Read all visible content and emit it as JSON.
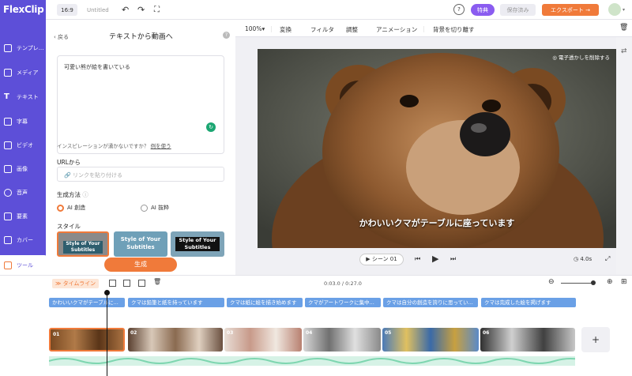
{
  "app": {
    "logo": "FlexClip"
  },
  "sidebar": {
    "items": [
      {
        "label": "テンプレ..."
      },
      {
        "label": "メディア"
      },
      {
        "label": "テキスト"
      },
      {
        "label": "字幕"
      },
      {
        "label": "ビデオ"
      },
      {
        "label": "画像"
      },
      {
        "label": "音声"
      },
      {
        "label": "要素"
      },
      {
        "label": "カバー"
      },
      {
        "label": "ツール"
      }
    ]
  },
  "topbar": {
    "ratio": "16:9",
    "title": "Untitled",
    "special": "特典",
    "save": "保存済み",
    "export": "エクスポート"
  },
  "panel": {
    "back": "戻る",
    "title": "テキストから動画へ",
    "prompt": "可愛い熊が絵を書いている",
    "inspiration": "インスピレーションが湧かないですか？",
    "example_link": "例を使う",
    "url_label": "URLから",
    "url_placeholder": "リンクを貼り付ける",
    "method_label": "生成方法",
    "method_ai_create": "AI 創造",
    "method_ai_extract": "AI 抜粋",
    "style_label": "スタイル",
    "style_card_text": "Style of Your Subtitles",
    "generate": "生成"
  },
  "toolbar": {
    "zoom": "100%",
    "items": [
      "変換",
      "フィルタ",
      "調整",
      "アニメーション",
      "背景を切り離す"
    ]
  },
  "preview": {
    "watermark": "電子透かしを削除する",
    "subtitle": "かわいいクマがテーブルに座っています",
    "scene": "シーン 01",
    "duration": "4.0s"
  },
  "timeline": {
    "label": "タイムライン",
    "time": "0:03.0 / 0:27.0",
    "subtitles": [
      "かわいいクマがテーブルに...",
      "クマは鉛筆と紙を持っています",
      "クマは紙に絵を描き始めます",
      "クマがアートワークに集中...",
      "クマは自分の創造を誇りに思ってい...",
      "クマは完成した絵を掲げます"
    ],
    "clips": [
      "01",
      "02",
      "03",
      "04",
      "05",
      "06"
    ],
    "add": "+"
  },
  "colors": {
    "accent": "#5d4fd8",
    "orange": "#f07a3a",
    "subtitle_track": "#6aa0e6",
    "audio": "#7ed6b0"
  }
}
